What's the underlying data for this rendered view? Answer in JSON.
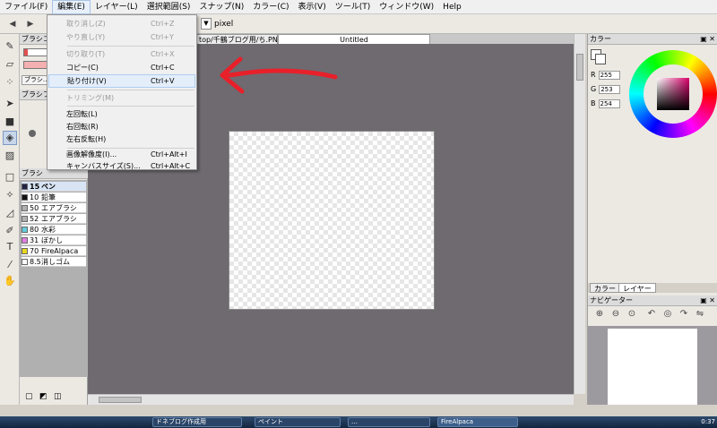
{
  "menubar": {
    "items": [
      "ファイル(F)",
      "編集(E)",
      "レイヤー(L)",
      "選択範囲(S)",
      "スナップ(N)",
      "カラー(C)",
      "表示(V)",
      "ツール(T)",
      "ウィンドウ(W)",
      "Help"
    ]
  },
  "toolbar": {
    "unit": "pixel"
  },
  "panels": {
    "brush_control_title": "ブラシコン",
    "brush_preview_title": "ブラシプレ",
    "brush_button": "ブラシ…",
    "brush_list_title": "ブラシ"
  },
  "brushes": [
    {
      "size": "15",
      "name": "ペン",
      "color": "#222244"
    },
    {
      "size": "10",
      "name": "鉛筆",
      "color": "#111111"
    },
    {
      "size": "50",
      "name": "エアブラシ",
      "color": "#b0b0b0"
    },
    {
      "size": "52",
      "name": "エアブラシ",
      "color": "#b0b0b0"
    },
    {
      "size": "80",
      "name": "水彩",
      "color": "#66ccdd"
    },
    {
      "size": "31",
      "name": "ぼかし",
      "color": "#e080e0"
    },
    {
      "size": "70",
      "name": "FireAlpaca",
      "color": "#e8d820"
    },
    {
      "size": "8.5",
      "name": "消しゴム",
      "color": "#ffffff"
    }
  ],
  "tabs": {
    "doc1": "top/千鶴ブログ用/ち.PNG",
    "doc2": "Untitled"
  },
  "edit_menu": {
    "undo": "取り消し(Z)",
    "undo_sc": "Ctrl+Z",
    "redo": "やり直し(Y)",
    "redo_sc": "Ctrl+Y",
    "cut": "切り取り(T)",
    "cut_sc": "Ctrl+X",
    "copy": "コピー(C)",
    "copy_sc": "Ctrl+C",
    "paste": "貼り付け(V)",
    "paste_sc": "Ctrl+V",
    "trim": "トリミング(M)",
    "rotate_left": "左回転(L)",
    "rotate_right": "右回転(R)",
    "flip": "左右反転(H)",
    "resolution": "画像解像度(I)...",
    "resolution_sc": "Ctrl+Alt+I",
    "canvas_size": "キャンバスサイズ(S)...",
    "canvas_size_sc": "Ctrl+Alt+C"
  },
  "color_panel": {
    "title": "カラー",
    "r_label": "R",
    "r": "255",
    "g_label": "G",
    "g": "253",
    "b_label": "B",
    "b": "254",
    "tab_color": "カラー",
    "tab_layer": "レイヤー"
  },
  "navigator": {
    "title": "ナビゲーター"
  },
  "taskbar": {
    "tasks": [
      "ドネブログ作成用",
      "ペイント",
      "…",
      "FireAlpaca"
    ],
    "clock": "0:37"
  },
  "colors": {
    "workspace": "#6e6a70",
    "accent_red": "#e8202a",
    "menu_highlight": "#e4eefb"
  }
}
